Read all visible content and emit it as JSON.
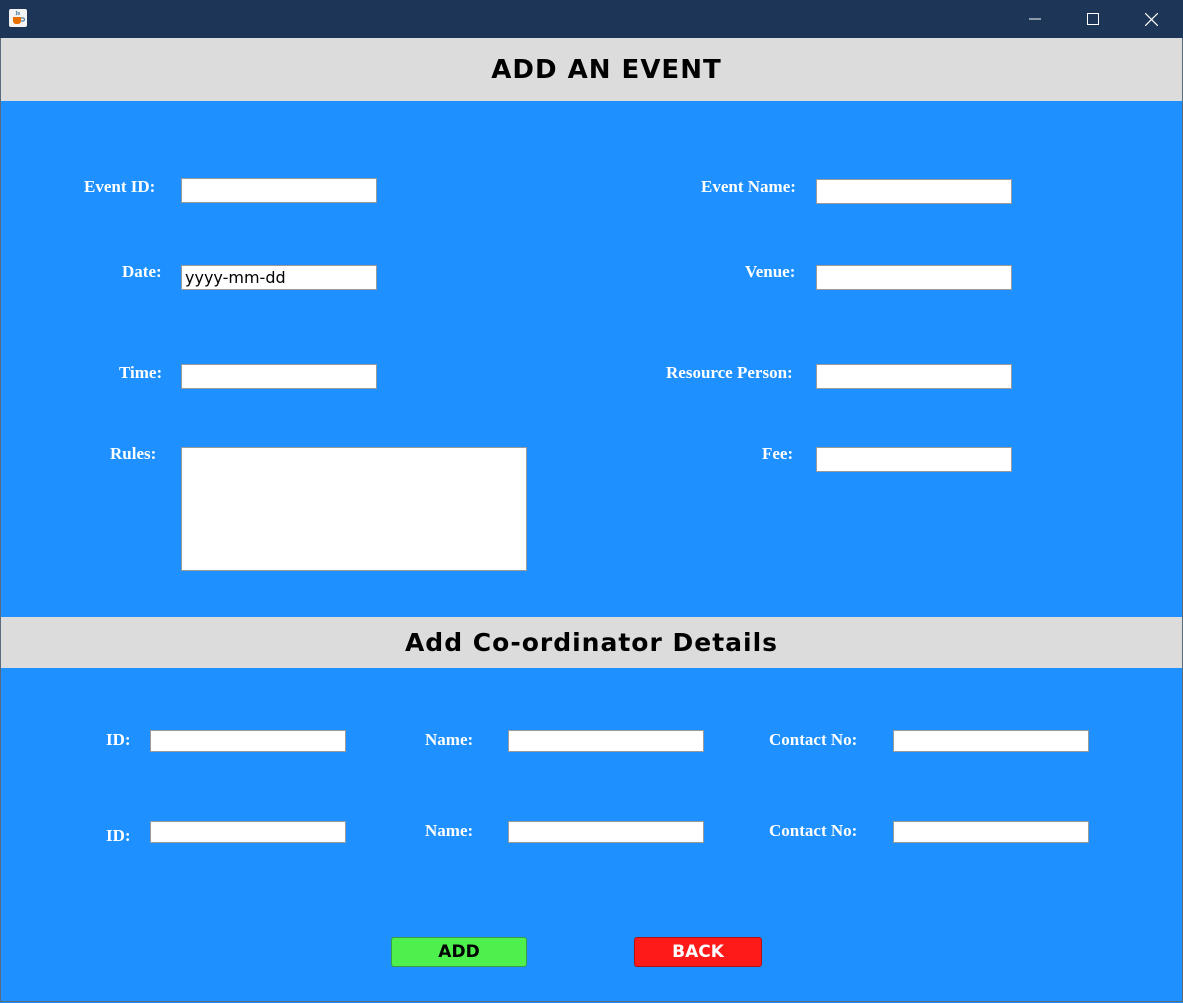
{
  "window": {
    "minimize_label": "Minimize",
    "maximize_label": "Maximize",
    "close_label": "Close"
  },
  "header": {
    "title": "ADD AN EVENT"
  },
  "event_form": {
    "event_id": {
      "label": "Event ID:",
      "value": ""
    },
    "event_name": {
      "label": "Event Name:",
      "value": ""
    },
    "date": {
      "label": "Date:",
      "value": "yyyy-mm-dd"
    },
    "venue": {
      "label": "Venue:",
      "value": ""
    },
    "time": {
      "label": "Time:",
      "value": ""
    },
    "resource_person": {
      "label": "Resource Person:",
      "value": ""
    },
    "rules": {
      "label": "Rules:",
      "value": ""
    },
    "fee": {
      "label": "Fee:",
      "value": ""
    }
  },
  "coordinator_section": {
    "title": "Add Co-ordinator Details"
  },
  "coordinators": [
    {
      "id_label": "ID:",
      "id_value": "",
      "name_label": "Name:",
      "name_value": "",
      "contact_label": "Contact No:",
      "contact_value": ""
    },
    {
      "id_label": "ID:",
      "id_value": "",
      "name_label": "Name:",
      "name_value": "",
      "contact_label": "Contact No:",
      "contact_value": ""
    }
  ],
  "actions": {
    "add_label": "ADD",
    "back_label": "BACK"
  },
  "colors": {
    "background": "#1e90ff",
    "banner": "#dcdcdc",
    "titlebar": "#1d3557",
    "add_button": "#4ef04e",
    "back_button": "#ff1a1a"
  },
  "icons": {
    "app": "java-cup-icon",
    "minimize": "minimize-icon",
    "maximize": "maximize-icon",
    "close": "close-icon"
  }
}
